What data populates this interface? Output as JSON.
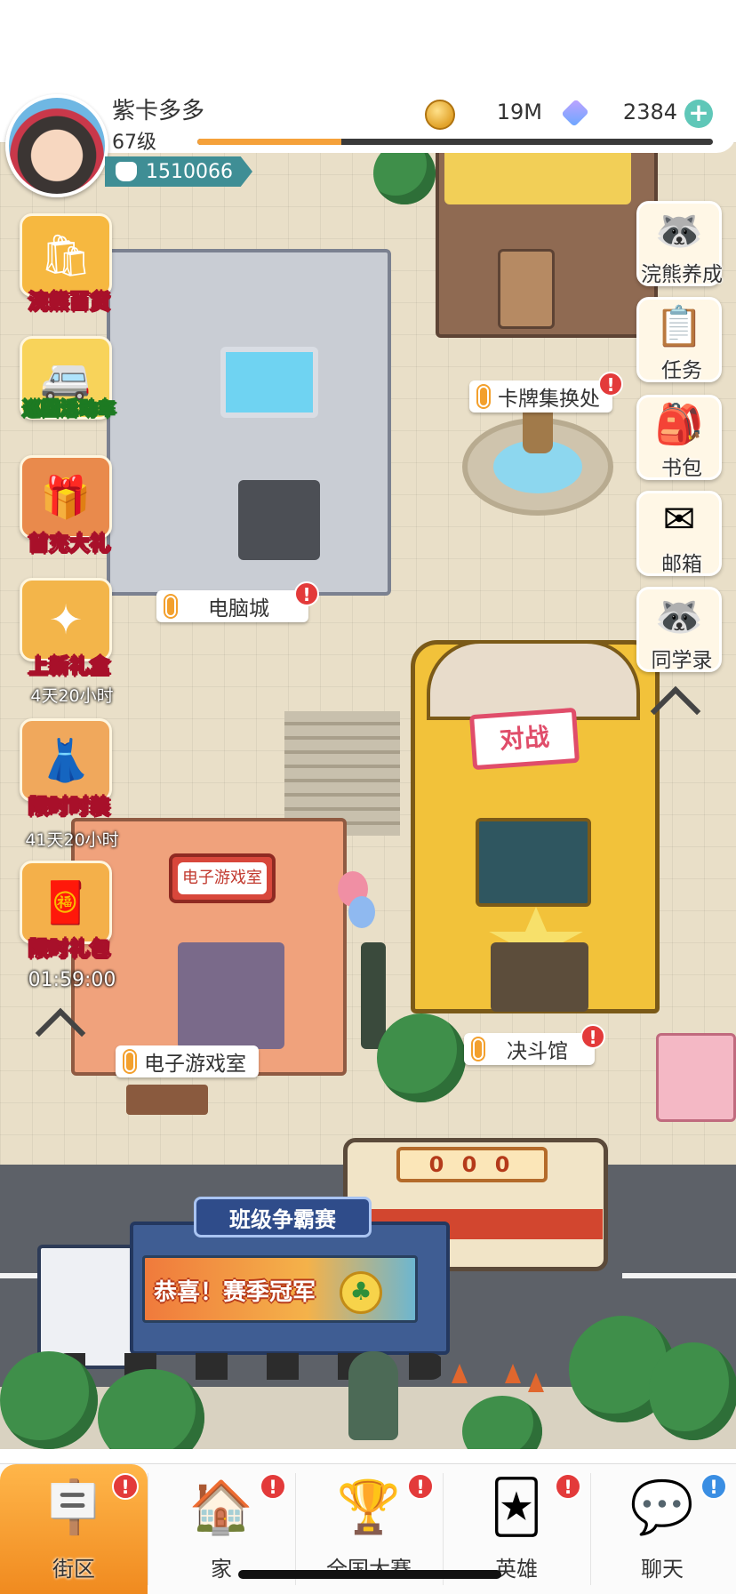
{
  "player": {
    "name": "紫卡多多",
    "level": "67级",
    "exp_progress": 0.28,
    "power": "1510066"
  },
  "currency": {
    "coins": "19M",
    "gems": "2384",
    "add_symbol": "+"
  },
  "left_events": [
    {
      "label": "浣熊百货",
      "icon": "shopping-bag-icon",
      "timer": ""
    },
    {
      "label": "巡回活动车",
      "icon": "event-van-icon",
      "timer": ""
    },
    {
      "label": "首充大礼",
      "icon": "first-recharge-icon",
      "timer": ""
    },
    {
      "label": "上新礼盒",
      "icon": "new-gift-box-icon",
      "timer": "4天20小时"
    },
    {
      "label": "限时时装",
      "icon": "limited-outfit-icon",
      "timer": "41天20小时"
    },
    {
      "label": "限时礼包",
      "icon": "red-envelope-icon",
      "timer": "01:59:00"
    }
  ],
  "right_menu": [
    {
      "label": "浣熊养成",
      "icon": "raccoon-icon"
    },
    {
      "label": "任务",
      "icon": "clipboard-icon"
    },
    {
      "label": "书包",
      "icon": "backpack-icon"
    },
    {
      "label": "邮箱",
      "icon": "envelope-icon"
    },
    {
      "label": "同学录",
      "icon": "classmates-icon"
    }
  ],
  "locations": {
    "card_exchange": "卡牌集换处",
    "computer_city": "电脑城",
    "arcade": "电子游戏室",
    "duel_hall": "决斗馆",
    "alert_symbol": "!"
  },
  "signs": {
    "battle_sign": "对战",
    "arcade_sign": "电子游戏室",
    "bus_display": "0 0 0"
  },
  "banner": {
    "title": "班级争霸赛",
    "subtitle": "恭喜！赛季冠军"
  },
  "bottom_nav": [
    {
      "label": "街区",
      "icon": "street-signpost-icon",
      "badge": "!",
      "active": true
    },
    {
      "label": "家",
      "icon": "house-icon",
      "badge": "!",
      "active": false
    },
    {
      "label": "全国大赛",
      "icon": "trophy-icon",
      "badge": "!",
      "active": false
    },
    {
      "label": "英雄",
      "icon": "hero-cards-icon",
      "badge": "!",
      "active": false
    },
    {
      "label": "聊天",
      "icon": "chat-bubble-icon",
      "badge": "!",
      "active": false
    }
  ],
  "colors": {
    "accent_orange": "#f08a1f",
    "alert_red": "#e33a3a",
    "power_teal": "#3f8e95"
  }
}
